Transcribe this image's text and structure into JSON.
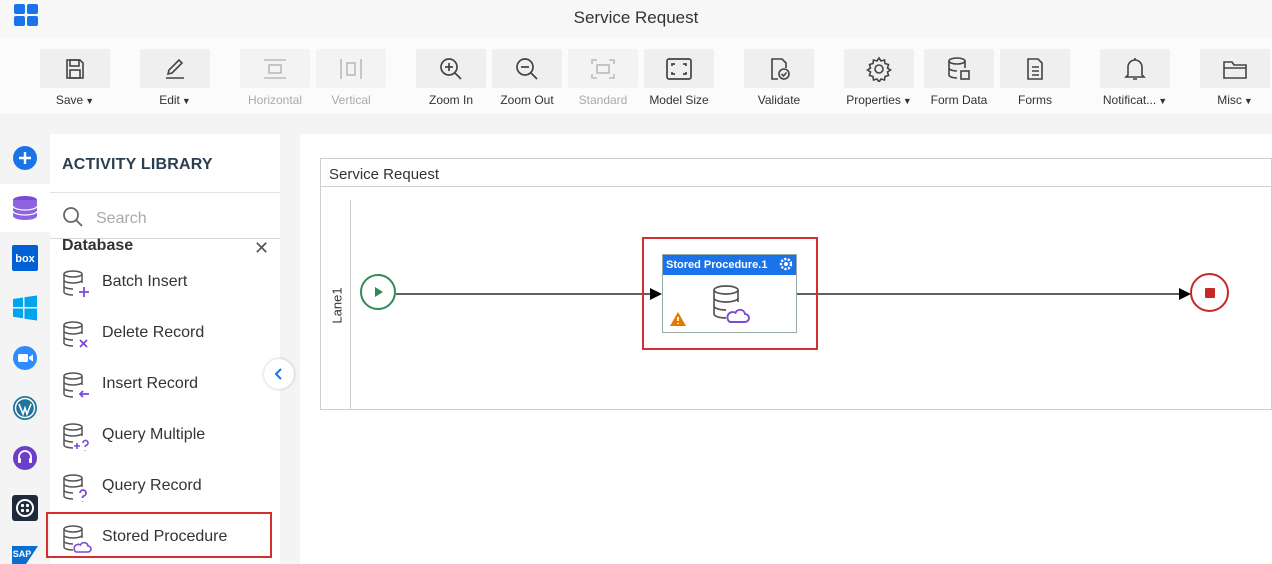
{
  "app": {
    "title": "Service Request"
  },
  "toolbar": {
    "save": "Save",
    "edit": "Edit",
    "horizontal": "Horizontal",
    "vertical": "Vertical",
    "zoom_in": "Zoom In",
    "zoom_out": "Zoom Out",
    "standard": "Standard",
    "model_size": "Model Size",
    "validate": "Validate",
    "properties": "Properties",
    "form_data": "Form Data",
    "forms": "Forms",
    "notifications": "Notificat...",
    "misc": "Misc"
  },
  "rail": {
    "items": [
      "add-icon",
      "database-icon",
      "box-icon",
      "windows-icon",
      "zoom-video-icon",
      "wordpress-icon",
      "support-headset-icon",
      "twilio-icon",
      "sap-icon"
    ],
    "box_text": "box",
    "sap_text": "SAP"
  },
  "library": {
    "title": "ACTIVITY LIBRARY",
    "search_placeholder": "Search",
    "category": "Database",
    "items": [
      {
        "label": "Batch Insert",
        "icon": "db-plus-icon"
      },
      {
        "label": "Delete Record",
        "icon": "db-x-icon"
      },
      {
        "label": "Insert Record",
        "icon": "db-arrow-icon"
      },
      {
        "label": "Query Multiple",
        "icon": "db-query-multiple-icon"
      },
      {
        "label": "Query Record",
        "icon": "db-question-icon"
      },
      {
        "label": "Stored Procedure",
        "icon": "db-cloud-icon"
      }
    ],
    "selected": "Stored Procedure"
  },
  "canvas": {
    "pool_title": "Service Request",
    "lane_label": "Lane1",
    "activity": {
      "title": "Stored Procedure.1",
      "warning": true
    }
  },
  "colors": {
    "accent": "#1a73e8",
    "highlight": "#d32f2f",
    "start": "#2e8b57",
    "end": "#c62828",
    "warning": "#e07b00",
    "purple": "#7b4ad8"
  }
}
